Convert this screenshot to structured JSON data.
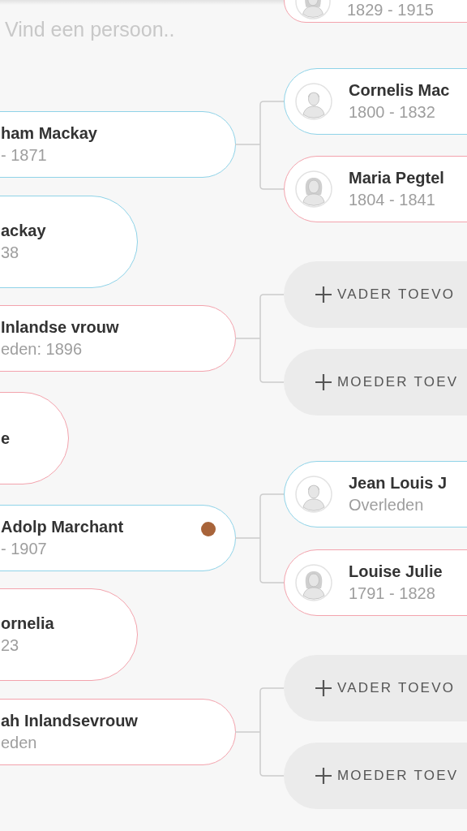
{
  "search": {
    "placeholder": "Vind een persoon.."
  },
  "top_card": {
    "kind": "woman",
    "dates": "1829 - 1915"
  },
  "outer_column": [
    {
      "kind": "man",
      "name": "ackay",
      "dates": "38"
    },
    {
      "kind": "woman",
      "name": "e"
    },
    {
      "kind": "woman",
      "name": "ornelia",
      "dates": "23"
    }
  ],
  "families": [
    {
      "child": {
        "kind": "man",
        "name": "ham Mackay",
        "dates": "- 1871"
      },
      "parents": [
        {
          "kind": "man",
          "name": "Cornelis Mac",
          "dates": "1800 - 1832"
        },
        {
          "kind": "woman",
          "name": "Maria Pegtel",
          "dates": "1804 - 1841"
        }
      ]
    },
    {
      "child": {
        "kind": "woman",
        "name": "Inlandse vrouw",
        "dates": "eden: 1896"
      },
      "parents": [
        {
          "kind": "add",
          "label": "VADER TOEVO"
        },
        {
          "kind": "add",
          "label": "MOEDER TOEV"
        }
      ]
    },
    {
      "child": {
        "kind": "man",
        "name": "Adolp Marchant",
        "dates": "- 1907",
        "color": "#a8643a"
      },
      "parents": [
        {
          "kind": "man",
          "name": "Jean Louis J",
          "dates": "Overleden"
        },
        {
          "kind": "woman",
          "name": "Louise Julie",
          "dates": "1791 - 1828"
        }
      ]
    },
    {
      "child": {
        "kind": "woman",
        "name": "ah Inlandsevrouw",
        "dates": "eden"
      },
      "parents": [
        {
          "kind": "add",
          "label": "VADER TOEVO"
        },
        {
          "kind": "add",
          "label": "MOEDER TOEV"
        }
      ]
    }
  ]
}
